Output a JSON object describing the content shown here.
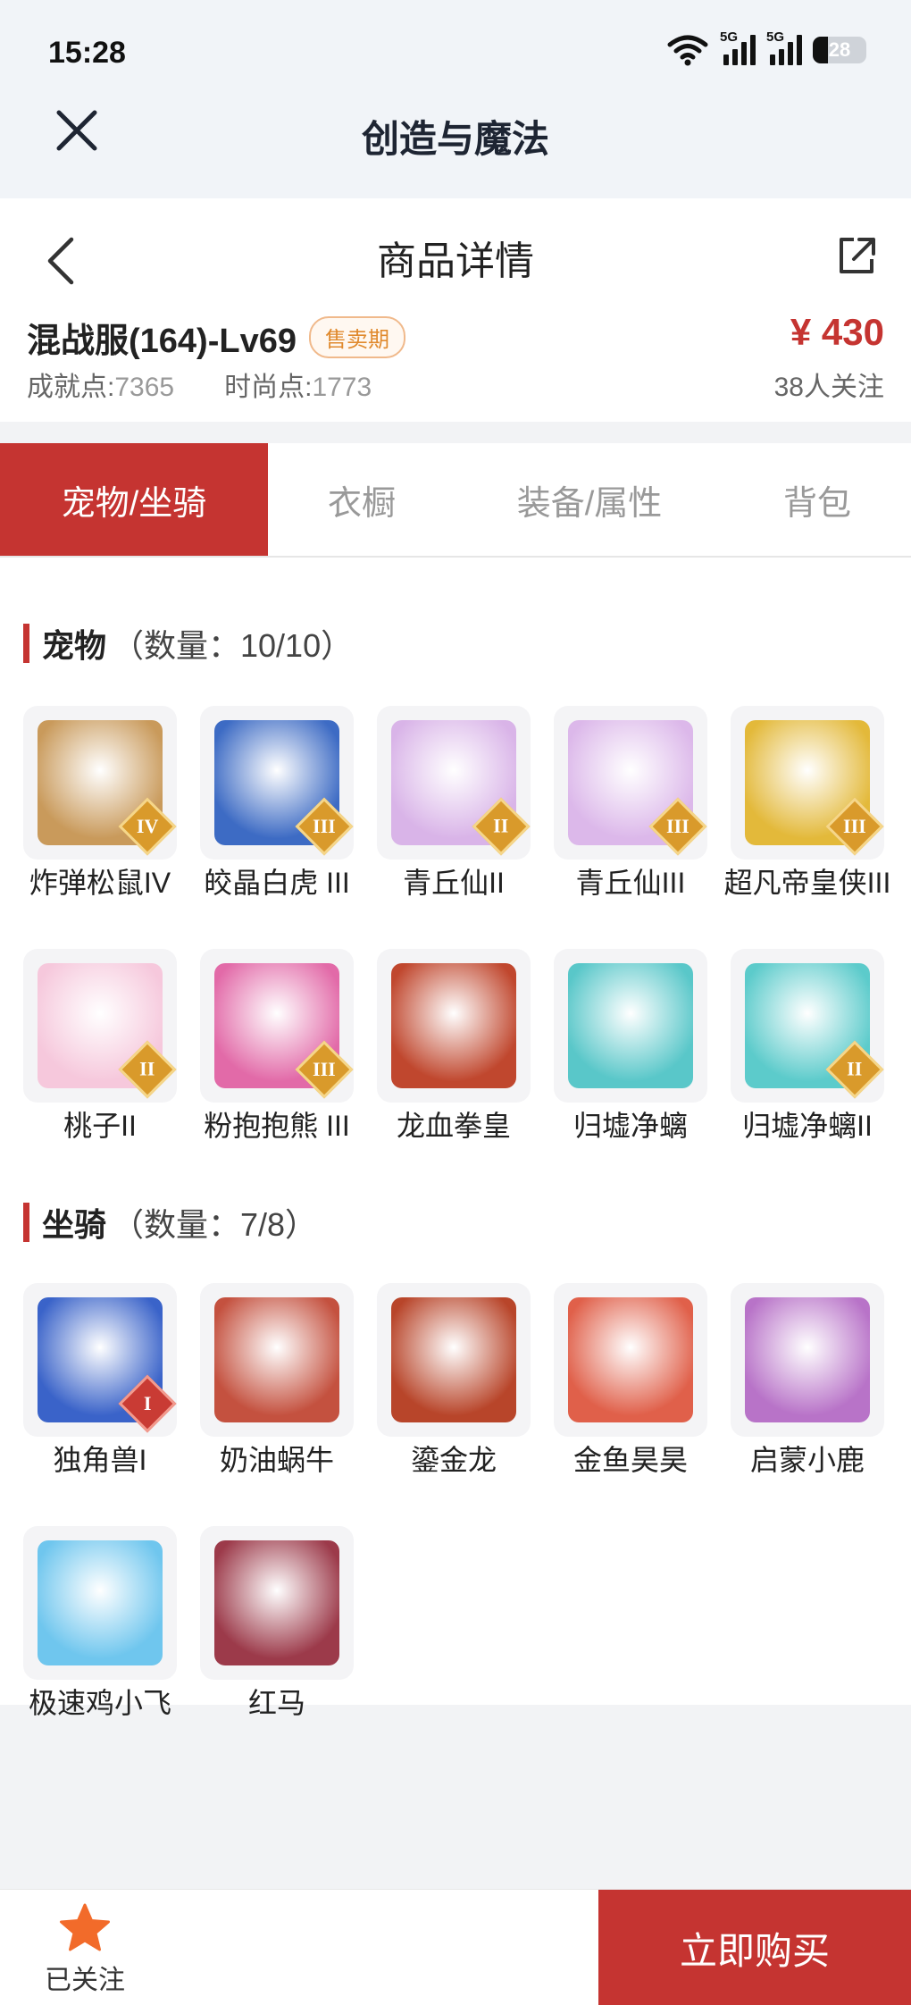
{
  "status": {
    "time": "15:28",
    "network1": "5G",
    "network2": "5G",
    "battery": "28",
    "battery_level": 0.28
  },
  "app": {
    "title": "创造与魔法"
  },
  "detail": {
    "title": "商品详情",
    "server": "混战服(164)-Lv69",
    "badge": "售卖期",
    "achieve_label": "成就点:",
    "achieve_value": "7365",
    "fashion_label": "时尚点:",
    "fashion_value": "1773",
    "price": "¥ 430",
    "follows": "38人关注"
  },
  "tabs": [
    "宠物/坐骑",
    "衣橱",
    "装备/属性",
    "背包"
  ],
  "pets": {
    "name": "宠物",
    "count": "（数量：10/10）",
    "items": [
      {
        "label": "炸弹松鼠IV",
        "rank": "IV",
        "icon": "squirrel-icon",
        "color": "#c99a5b",
        "rank_color": "gold"
      },
      {
        "label": "皎晶白虎 III",
        "rank": "III",
        "icon": "white-tiger-icon",
        "color": "#3d6bc4",
        "rank_color": "gold"
      },
      {
        "label": "青丘仙II",
        "rank": "II",
        "icon": "fox-fairy-icon",
        "color": "#d9b4e8",
        "rank_color": "gold"
      },
      {
        "label": "青丘仙III",
        "rank": "III",
        "icon": "fox-fairy-icon",
        "color": "#dcb8ea",
        "rank_color": "gold"
      },
      {
        "label": "超凡帝皇侠III",
        "rank": "III",
        "icon": "emperor-knight-icon",
        "color": "#e3b93a",
        "rank_color": "gold"
      },
      {
        "label": "桃子II",
        "rank": "II",
        "icon": "peach-cat-icon",
        "color": "#f6c8dc",
        "rank_color": "gold"
      },
      {
        "label": "粉抱抱熊 III",
        "rank": "III",
        "icon": "pink-bear-icon",
        "color": "#e26aa8",
        "rank_color": "gold"
      },
      {
        "label": "龙血拳皇",
        "rank": "",
        "icon": "dragon-blood-boxer-icon",
        "color": "#c0472e",
        "rank_color": ""
      },
      {
        "label": "归墟净螭",
        "rank": "",
        "icon": "sea-dragon-icon",
        "color": "#59c7c9",
        "rank_color": ""
      },
      {
        "label": "归墟净螭II",
        "rank": "II",
        "icon": "sea-dragon-icon",
        "color": "#5ccbcb",
        "rank_color": "gold"
      }
    ]
  },
  "mounts": {
    "name": "坐骑",
    "count": "（数量：7/8）",
    "items": [
      {
        "label": "独角兽I",
        "rank": "I",
        "icon": "unicorn-icon",
        "color": "#3a63c9",
        "rank_color": "red"
      },
      {
        "label": "奶油蜗牛",
        "rank": "",
        "icon": "cream-snail-icon",
        "color": "#c4513f",
        "rank_color": ""
      },
      {
        "label": "鎏金龙",
        "rank": "",
        "icon": "golden-dragon-icon",
        "color": "#b8452a",
        "rank_color": ""
      },
      {
        "label": "金鱼昊昊",
        "rank": "",
        "icon": "goldfish-icon",
        "color": "#e0604a",
        "rank_color": ""
      },
      {
        "label": "启蒙小鹿",
        "rank": "",
        "icon": "deer-icon",
        "color": "#b873c8",
        "rank_color": ""
      },
      {
        "label": "极速鸡小飞",
        "rank": "",
        "icon": "blue-chick-icon",
        "color": "#6fc6ee",
        "rank_color": ""
      },
      {
        "label": "红马",
        "rank": "",
        "icon": "red-horse-icon",
        "color": "#9c3a4a",
        "rank_color": ""
      }
    ]
  },
  "bottom": {
    "follow_label": "已关注",
    "buy_label": "立即购买"
  },
  "colors": {
    "accent": "#c53431",
    "badge": "#e08a2e",
    "star": "#f26b2a"
  }
}
